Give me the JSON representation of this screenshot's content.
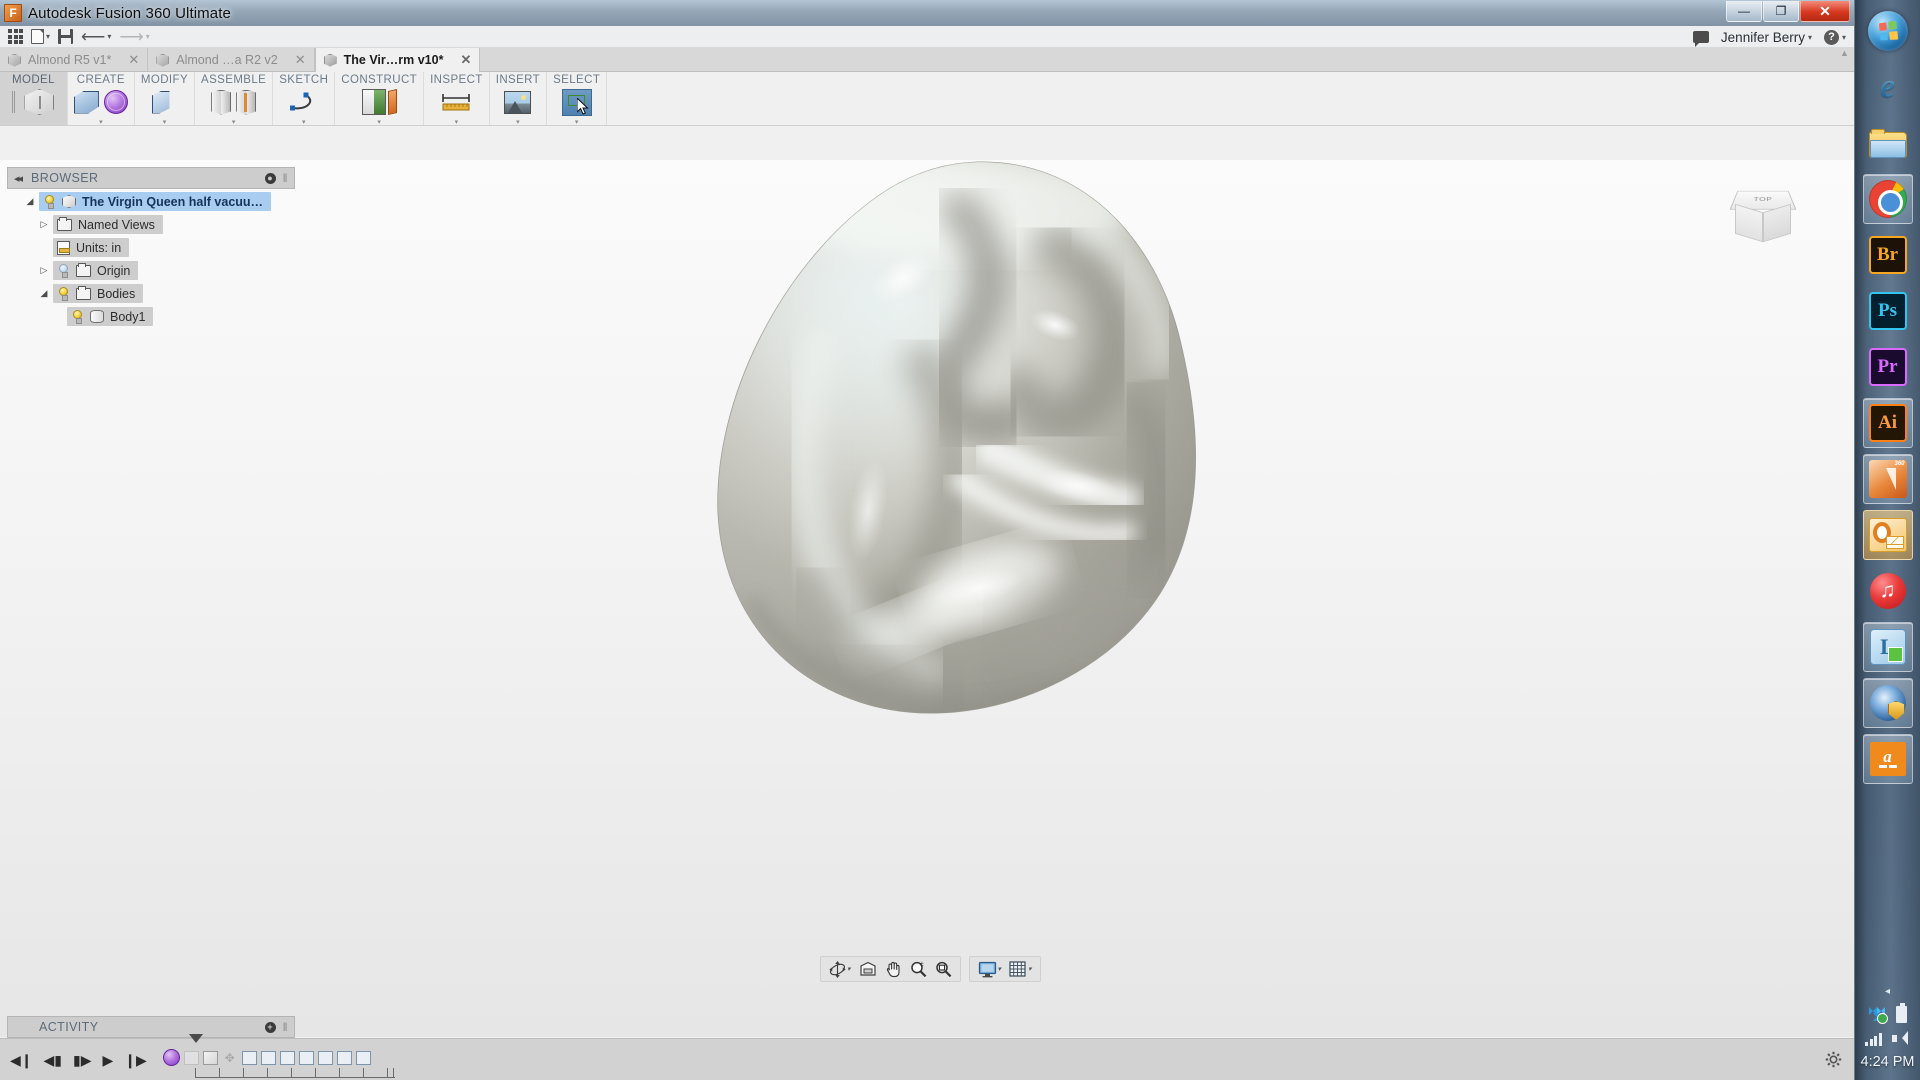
{
  "window": {
    "title": "Autodesk Fusion 360 Ultimate",
    "app_icon": "fusion360-icon",
    "minimize_label": "—",
    "maximize_label": "❐",
    "close_label": "✕"
  },
  "qat": {
    "apps_grid_label": "show-data-panel",
    "new_label": "file-new",
    "save_label": "save",
    "undo_label": "undo",
    "redo_label": "redo",
    "caret": "▾",
    "comment_label": "comments",
    "username": "Jennifer Berry",
    "user_caret": "▾",
    "help_label": "?",
    "help_caret": "▾"
  },
  "doc_tabs": [
    {
      "label": "Almond R5 v1*",
      "active": false,
      "close": "✕"
    },
    {
      "label": "Almond …a R2 v2",
      "active": false,
      "close": "✕"
    },
    {
      "label": "The Vir…rm v10*",
      "active": true,
      "close": "✕"
    }
  ],
  "ribbon": {
    "workspace": {
      "label": "MODEL",
      "icon": "model-cube-icon"
    },
    "panels": [
      {
        "label": "CREATE",
        "caret": "▾",
        "icons": [
          "box-icon",
          "sphere-icon"
        ]
      },
      {
        "label": "MODIFY",
        "caret": "▾",
        "icons": [
          "press-pull-icon"
        ]
      },
      {
        "label": "ASSEMBLE",
        "caret": "▾",
        "icons": [
          "joint-icon",
          "as-built-joint-icon"
        ]
      },
      {
        "label": "SKETCH",
        "caret": "▾",
        "icons": [
          "spline-icon"
        ]
      },
      {
        "label": "CONSTRUCT",
        "caret": "▾",
        "icons": [
          "construction-plane-icon"
        ]
      },
      {
        "label": "INSPECT",
        "caret": "▾",
        "icons": [
          "measure-ruler-icon"
        ]
      },
      {
        "label": "INSERT",
        "caret": "▾",
        "icons": [
          "insert-image-icon"
        ]
      },
      {
        "label": "SELECT",
        "caret": "▾",
        "icons": [
          "select-window-icon"
        ]
      }
    ]
  },
  "browser": {
    "title": "BROWSER",
    "collapse_icon": "◂◂",
    "settings_icon": "●",
    "grip_icon": "‖",
    "tree": [
      {
        "label": "The Virgin Queen half vacuu…",
        "indent": 0,
        "expander": "◢",
        "bulb": "on",
        "icon": "component-cube-icon",
        "selected": true
      },
      {
        "label": "Named Views",
        "indent": 1,
        "expander": "▷",
        "bulb": "none",
        "icon": "folder-icon",
        "selected": false
      },
      {
        "label": "Units: in",
        "indent": 1,
        "expander": "",
        "bulb": "none",
        "icon": "units-doc-icon",
        "selected": false
      },
      {
        "label": "Origin",
        "indent": 1,
        "expander": "▷",
        "bulb": "off",
        "icon": "folder-icon",
        "selected": false
      },
      {
        "label": "Bodies",
        "indent": 1,
        "expander": "◢",
        "bulb": "on",
        "icon": "folder-icon",
        "selected": false
      },
      {
        "label": "Body1",
        "indent": 2,
        "expander": "",
        "bulb": "on",
        "icon": "body-cylinder-icon",
        "selected": false
      }
    ]
  },
  "canvas": {
    "viewcube_top_label": "TOP",
    "model_name": "almond-shaped-solid-body",
    "background_top": "#fbfbfb",
    "background_bottom": "#e6e6e6"
  },
  "navbar": {
    "group1": [
      {
        "name": "orbit-tool",
        "caret": "▾"
      },
      {
        "name": "look-at-tool",
        "caret": ""
      },
      {
        "name": "pan-tool",
        "caret": ""
      },
      {
        "name": "zoom-tool",
        "caret": ""
      },
      {
        "name": "fit-tool",
        "caret": ""
      }
    ],
    "group2": [
      {
        "name": "display-settings",
        "caret": "▾"
      },
      {
        "name": "grid-snaps",
        "caret": "▾"
      }
    ]
  },
  "activity": {
    "title": "ACTIVITY",
    "add_icon": "⊕",
    "grip_icon": "‖"
  },
  "timeline": {
    "playback": [
      {
        "name": "go-to-beginning",
        "glyph": "◀❙"
      },
      {
        "name": "step-back",
        "glyph": "◀▮"
      },
      {
        "name": "step-forward",
        "glyph": "▮▶"
      },
      {
        "name": "play",
        "glyph": "▶"
      },
      {
        "name": "go-to-end",
        "glyph": "❙▶"
      }
    ],
    "features": [
      {
        "name": "sphere-feature",
        "type": "sphere"
      },
      {
        "name": "sketch-feature",
        "type": "ghost"
      },
      {
        "name": "extrude-feature",
        "type": "solid"
      },
      {
        "name": "move-feature",
        "type": "move"
      },
      {
        "name": "form-feature-1",
        "type": "stack"
      },
      {
        "name": "form-feature-2",
        "type": "stack"
      },
      {
        "name": "form-feature-3",
        "type": "stack"
      },
      {
        "name": "form-feature-4",
        "type": "stack"
      },
      {
        "name": "form-feature-5",
        "type": "stack"
      },
      {
        "name": "form-feature-6",
        "type": "stack"
      },
      {
        "name": "form-feature-7",
        "type": "stack"
      }
    ],
    "settings_icon": "gear-icon"
  },
  "taskbar": {
    "items": [
      {
        "name": "start-orb",
        "state": "none"
      },
      {
        "name": "internet-explorer-icon",
        "state": "none"
      },
      {
        "name": "file-explorer-icon",
        "state": "none"
      },
      {
        "name": "google-chrome-icon",
        "state": "running"
      },
      {
        "name": "adobe-bridge-icon",
        "state": "none",
        "label": "Br"
      },
      {
        "name": "adobe-photoshop-icon",
        "state": "none",
        "label": "Ps"
      },
      {
        "name": "adobe-premiere-icon",
        "state": "none",
        "label": "Pr"
      },
      {
        "name": "adobe-illustrator-icon",
        "state": "running",
        "label": "Ai"
      },
      {
        "name": "fusion-360-icon",
        "state": "running",
        "label": "360"
      },
      {
        "name": "microsoft-outlook-icon",
        "state": "active"
      },
      {
        "name": "itunes-icon",
        "state": "none",
        "label": "♫"
      },
      {
        "name": "skype-for-business-icon",
        "state": "running",
        "label": "L"
      },
      {
        "name": "windows-defender-icon",
        "state": "running"
      },
      {
        "name": "amazon-icon",
        "state": "running",
        "label": "a"
      }
    ],
    "tray": {
      "expand_icon": "◂",
      "dropbox_icon": "dropbox-icon",
      "clipboard_icon": "clipboard-icon",
      "network_icon": "network-signal-icon",
      "volume_icon": "volume-icon",
      "clock": "4:24 PM"
    }
  }
}
